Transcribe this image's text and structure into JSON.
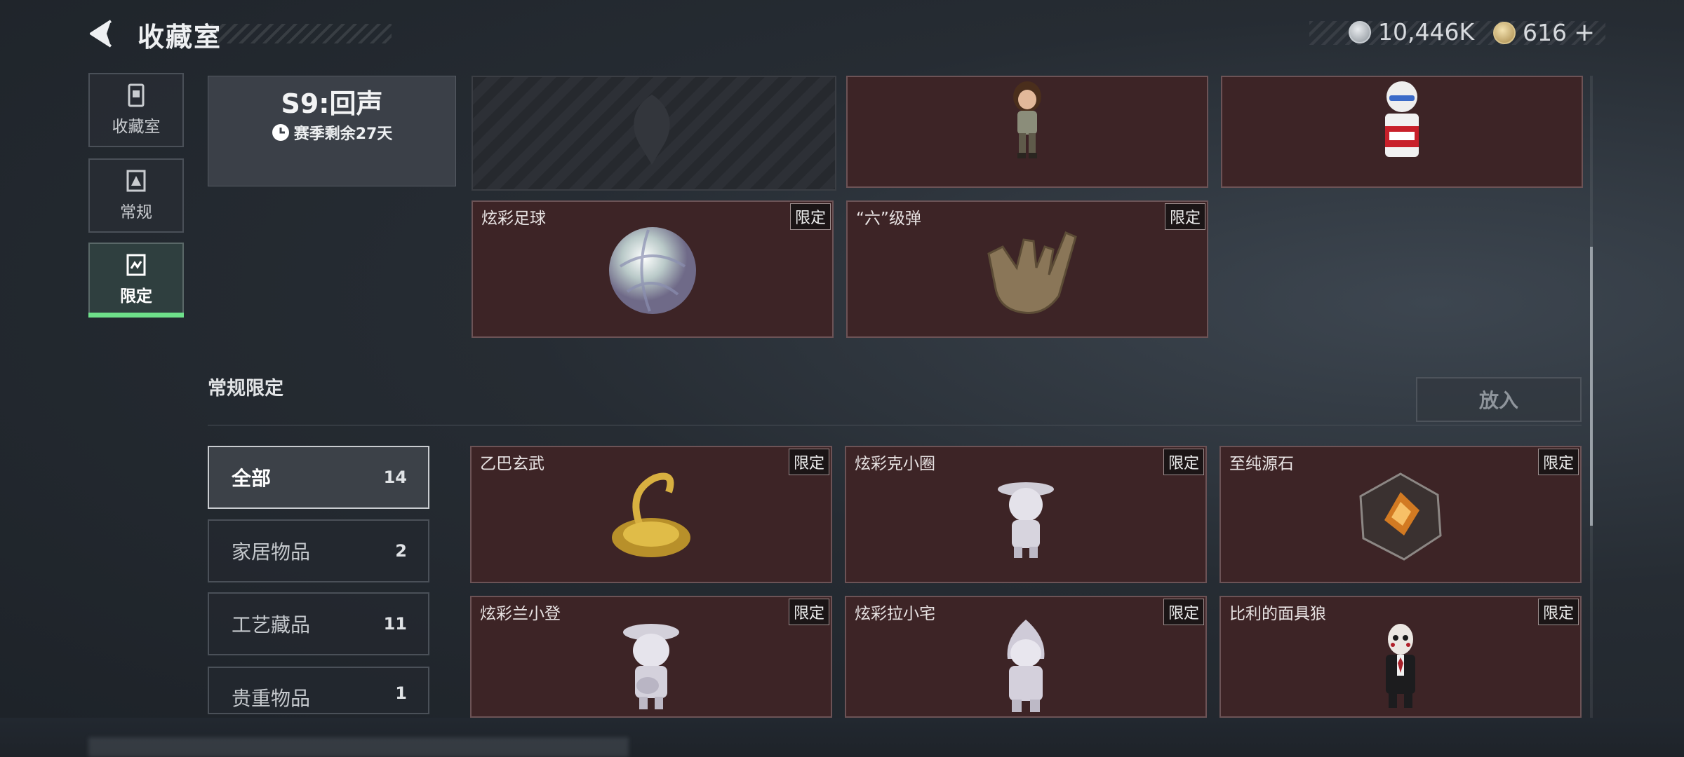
{
  "header": {
    "title": "收藏室",
    "currency1": {
      "icon": "silver-coin-icon",
      "value": "10,446K"
    },
    "currency2": {
      "icon": "gold-coin-icon",
      "value": "616"
    },
    "add_symbol": "+"
  },
  "sidebar": {
    "items": [
      {
        "label": "收藏室",
        "icon": "collection-icon"
      },
      {
        "label": "常规",
        "icon": "regular-icon"
      },
      {
        "label": "限定",
        "icon": "limited-icon",
        "active": true
      }
    ]
  },
  "season": {
    "title": "S9:回声",
    "remaining": "赛季剩余27天"
  },
  "top_cards": [
    {
      "name": "",
      "badge": "",
      "icon": "tomb-raider-figure-icon"
    },
    {
      "name": "",
      "badge": "",
      "icon": "kfc-colonel-figure-icon"
    },
    {
      "name": "炫彩足球",
      "badge": "限定",
      "icon": "iridescent-football-icon"
    },
    {
      "name": "“六”级弹",
      "badge": "限定",
      "icon": "golden-hand-icon"
    }
  ],
  "section": {
    "title": "常规限定",
    "put_button": "放入"
  },
  "filters": [
    {
      "label": "全部",
      "count": "14"
    },
    {
      "label": "家居物品",
      "count": "2"
    },
    {
      "label": "工艺藏品",
      "count": "11"
    },
    {
      "label": "贵重物品",
      "count": "1"
    }
  ],
  "items": [
    {
      "name": "乙巴玄武",
      "badge": "限定",
      "icon": "golden-turtle-snake-icon"
    },
    {
      "name": "炫彩克小圈",
      "badge": "限定",
      "icon": "silver-figure-hat-icon"
    },
    {
      "name": "至纯源石",
      "badge": "限定",
      "icon": "pure-source-stone-icon"
    },
    {
      "name": "炫彩兰小登",
      "badge": "限定",
      "icon": "silver-figure-guitar-icon"
    },
    {
      "name": "炫彩拉小宅",
      "badge": "限定",
      "icon": "silver-figure-hood-icon"
    },
    {
      "name": "比利的面具狼",
      "badge": "限定",
      "icon": "billy-puppet-icon"
    }
  ]
}
